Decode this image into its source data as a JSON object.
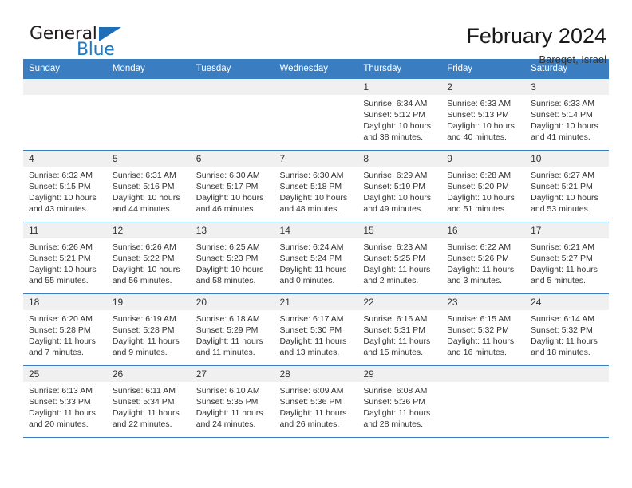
{
  "logo": {
    "word_one": "General",
    "word_two": "Blue",
    "triangle_icon": "triangle-icon"
  },
  "header": {
    "title": "February 2024",
    "subtitle": "Bareqet, Israel"
  },
  "colors": {
    "header_blue": "#3a7dc0",
    "daynum_gray": "#f0f0f0",
    "logo_blue": "#1f7ac4",
    "text": "#333333"
  },
  "calendar": {
    "weekdays": [
      "Sunday",
      "Monday",
      "Tuesday",
      "Wednesday",
      "Thursday",
      "Friday",
      "Saturday"
    ],
    "labels": {
      "sunrise": "Sunrise:",
      "sunset": "Sunset:",
      "daylight": "Daylight:"
    },
    "weeks": [
      [
        {
          "day": "",
          "lines": []
        },
        {
          "day": "",
          "lines": []
        },
        {
          "day": "",
          "lines": []
        },
        {
          "day": "",
          "lines": []
        },
        {
          "day": "1",
          "lines": [
            "Sunrise: 6:34 AM",
            "Sunset: 5:12 PM",
            "Daylight: 10 hours",
            "and 38 minutes."
          ]
        },
        {
          "day": "2",
          "lines": [
            "Sunrise: 6:33 AM",
            "Sunset: 5:13 PM",
            "Daylight: 10 hours",
            "and 40 minutes."
          ]
        },
        {
          "day": "3",
          "lines": [
            "Sunrise: 6:33 AM",
            "Sunset: 5:14 PM",
            "Daylight: 10 hours",
            "and 41 minutes."
          ]
        }
      ],
      [
        {
          "day": "4",
          "lines": [
            "Sunrise: 6:32 AM",
            "Sunset: 5:15 PM",
            "Daylight: 10 hours",
            "and 43 minutes."
          ]
        },
        {
          "day": "5",
          "lines": [
            "Sunrise: 6:31 AM",
            "Sunset: 5:16 PM",
            "Daylight: 10 hours",
            "and 44 minutes."
          ]
        },
        {
          "day": "6",
          "lines": [
            "Sunrise: 6:30 AM",
            "Sunset: 5:17 PM",
            "Daylight: 10 hours",
            "and 46 minutes."
          ]
        },
        {
          "day": "7",
          "lines": [
            "Sunrise: 6:30 AM",
            "Sunset: 5:18 PM",
            "Daylight: 10 hours",
            "and 48 minutes."
          ]
        },
        {
          "day": "8",
          "lines": [
            "Sunrise: 6:29 AM",
            "Sunset: 5:19 PM",
            "Daylight: 10 hours",
            "and 49 minutes."
          ]
        },
        {
          "day": "9",
          "lines": [
            "Sunrise: 6:28 AM",
            "Sunset: 5:20 PM",
            "Daylight: 10 hours",
            "and 51 minutes."
          ]
        },
        {
          "day": "10",
          "lines": [
            "Sunrise: 6:27 AM",
            "Sunset: 5:21 PM",
            "Daylight: 10 hours",
            "and 53 minutes."
          ]
        }
      ],
      [
        {
          "day": "11",
          "lines": [
            "Sunrise: 6:26 AM",
            "Sunset: 5:21 PM",
            "Daylight: 10 hours",
            "and 55 minutes."
          ]
        },
        {
          "day": "12",
          "lines": [
            "Sunrise: 6:26 AM",
            "Sunset: 5:22 PM",
            "Daylight: 10 hours",
            "and 56 minutes."
          ]
        },
        {
          "day": "13",
          "lines": [
            "Sunrise: 6:25 AM",
            "Sunset: 5:23 PM",
            "Daylight: 10 hours",
            "and 58 minutes."
          ]
        },
        {
          "day": "14",
          "lines": [
            "Sunrise: 6:24 AM",
            "Sunset: 5:24 PM",
            "Daylight: 11 hours",
            "and 0 minutes."
          ]
        },
        {
          "day": "15",
          "lines": [
            "Sunrise: 6:23 AM",
            "Sunset: 5:25 PM",
            "Daylight: 11 hours",
            "and 2 minutes."
          ]
        },
        {
          "day": "16",
          "lines": [
            "Sunrise: 6:22 AM",
            "Sunset: 5:26 PM",
            "Daylight: 11 hours",
            "and 3 minutes."
          ]
        },
        {
          "day": "17",
          "lines": [
            "Sunrise: 6:21 AM",
            "Sunset: 5:27 PM",
            "Daylight: 11 hours",
            "and 5 minutes."
          ]
        }
      ],
      [
        {
          "day": "18",
          "lines": [
            "Sunrise: 6:20 AM",
            "Sunset: 5:28 PM",
            "Daylight: 11 hours",
            "and 7 minutes."
          ]
        },
        {
          "day": "19",
          "lines": [
            "Sunrise: 6:19 AM",
            "Sunset: 5:28 PM",
            "Daylight: 11 hours",
            "and 9 minutes."
          ]
        },
        {
          "day": "20",
          "lines": [
            "Sunrise: 6:18 AM",
            "Sunset: 5:29 PM",
            "Daylight: 11 hours",
            "and 11 minutes."
          ]
        },
        {
          "day": "21",
          "lines": [
            "Sunrise: 6:17 AM",
            "Sunset: 5:30 PM",
            "Daylight: 11 hours",
            "and 13 minutes."
          ]
        },
        {
          "day": "22",
          "lines": [
            "Sunrise: 6:16 AM",
            "Sunset: 5:31 PM",
            "Daylight: 11 hours",
            "and 15 minutes."
          ]
        },
        {
          "day": "23",
          "lines": [
            "Sunrise: 6:15 AM",
            "Sunset: 5:32 PM",
            "Daylight: 11 hours",
            "and 16 minutes."
          ]
        },
        {
          "day": "24",
          "lines": [
            "Sunrise: 6:14 AM",
            "Sunset: 5:32 PM",
            "Daylight: 11 hours",
            "and 18 minutes."
          ]
        }
      ],
      [
        {
          "day": "25",
          "lines": [
            "Sunrise: 6:13 AM",
            "Sunset: 5:33 PM",
            "Daylight: 11 hours",
            "and 20 minutes."
          ]
        },
        {
          "day": "26",
          "lines": [
            "Sunrise: 6:11 AM",
            "Sunset: 5:34 PM",
            "Daylight: 11 hours",
            "and 22 minutes."
          ]
        },
        {
          "day": "27",
          "lines": [
            "Sunrise: 6:10 AM",
            "Sunset: 5:35 PM",
            "Daylight: 11 hours",
            "and 24 minutes."
          ]
        },
        {
          "day": "28",
          "lines": [
            "Sunrise: 6:09 AM",
            "Sunset: 5:36 PM",
            "Daylight: 11 hours",
            "and 26 minutes."
          ]
        },
        {
          "day": "29",
          "lines": [
            "Sunrise: 6:08 AM",
            "Sunset: 5:36 PM",
            "Daylight: 11 hours",
            "and 28 minutes."
          ]
        },
        {
          "day": "",
          "lines": []
        },
        {
          "day": "",
          "lines": []
        }
      ]
    ]
  }
}
